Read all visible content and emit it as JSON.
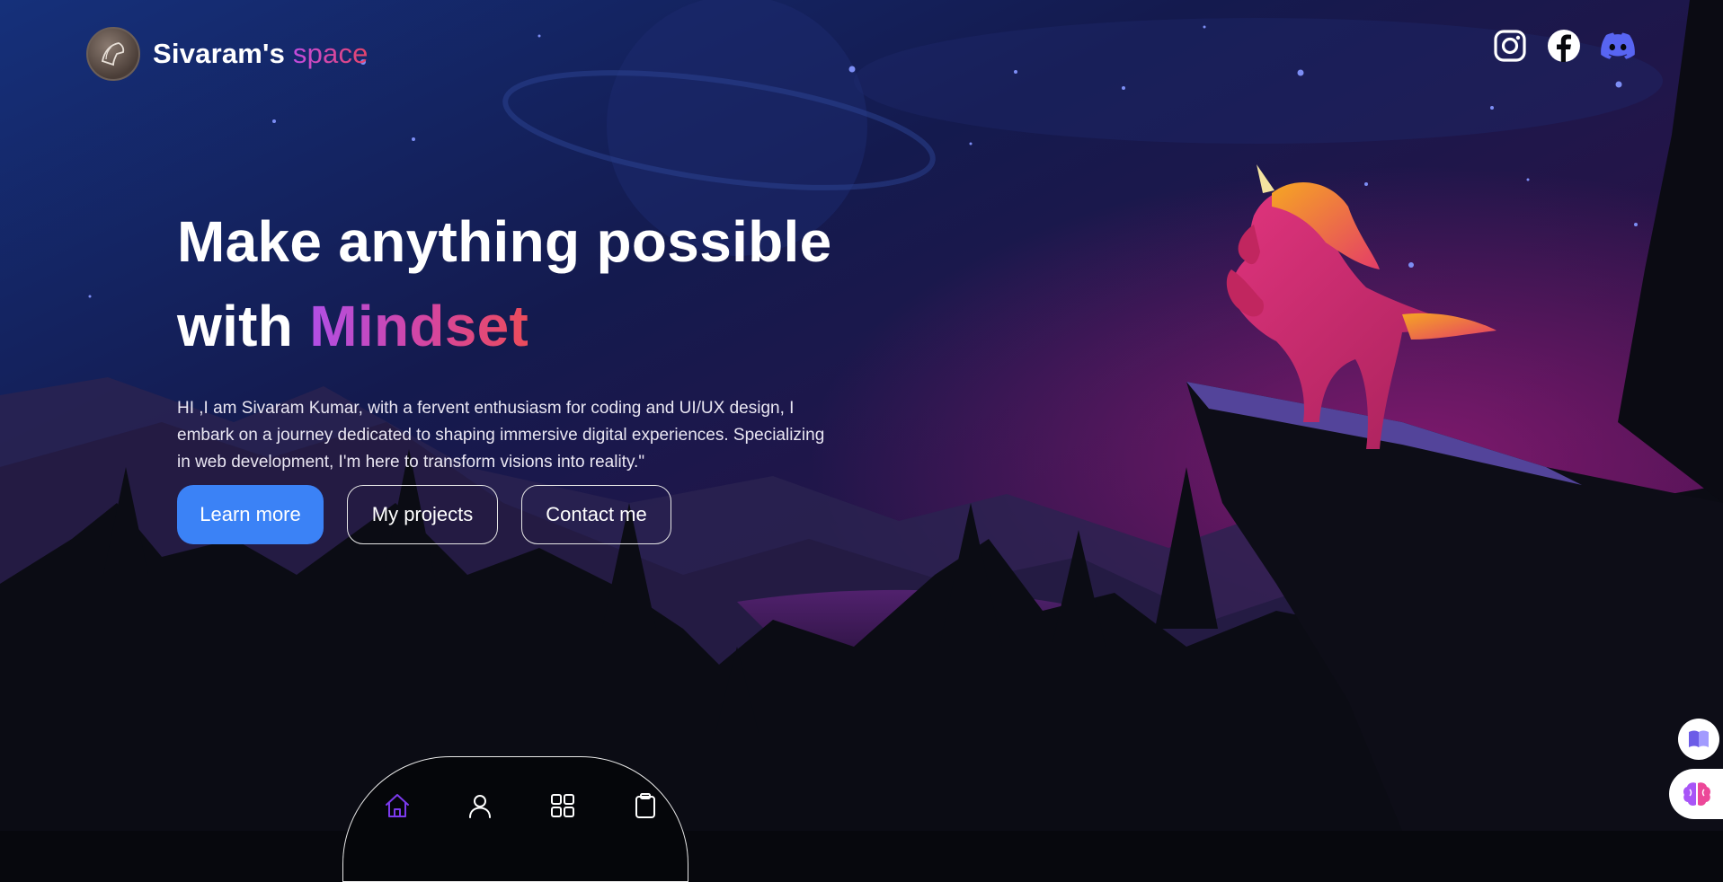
{
  "brand": {
    "name": "Sivaram's",
    "accent": "space"
  },
  "social": [
    {
      "name": "instagram",
      "icon": "instagram-icon"
    },
    {
      "name": "facebook",
      "icon": "facebook-icon"
    },
    {
      "name": "discord",
      "icon": "discord-icon"
    }
  ],
  "hero": {
    "line1": "Make anything possible",
    "line2_prefix": "with",
    "line2_highlight": "Mindset",
    "description": "HI ,I am Sivaram Kumar, with a fervent enthusiasm for coding and UI/UX design, I embark on a journey dedicated to shaping immersive digital experiences. Specializing in web development, I'm here to transform visions into reality.\""
  },
  "buttons": {
    "learn_more": "Learn more",
    "projects": "My projects",
    "contact": "Contact me"
  },
  "dock": [
    {
      "name": "home",
      "icon": "home-icon",
      "active": true
    },
    {
      "name": "profile",
      "icon": "user-icon",
      "active": false
    },
    {
      "name": "apps",
      "icon": "grid-icon",
      "active": false
    },
    {
      "name": "notes",
      "icon": "clipboard-icon",
      "active": false
    }
  ],
  "floating": [
    {
      "name": "reader",
      "icon": "book-icon"
    },
    {
      "name": "assistant",
      "icon": "brain-icon"
    }
  ],
  "colors": {
    "primary_button": "#3b82f6",
    "accent_gradient_start": "#b04fe6",
    "accent_gradient_end": "#ec4c5a",
    "dock_active": "#7c3aed",
    "discord": "#5865f2"
  }
}
